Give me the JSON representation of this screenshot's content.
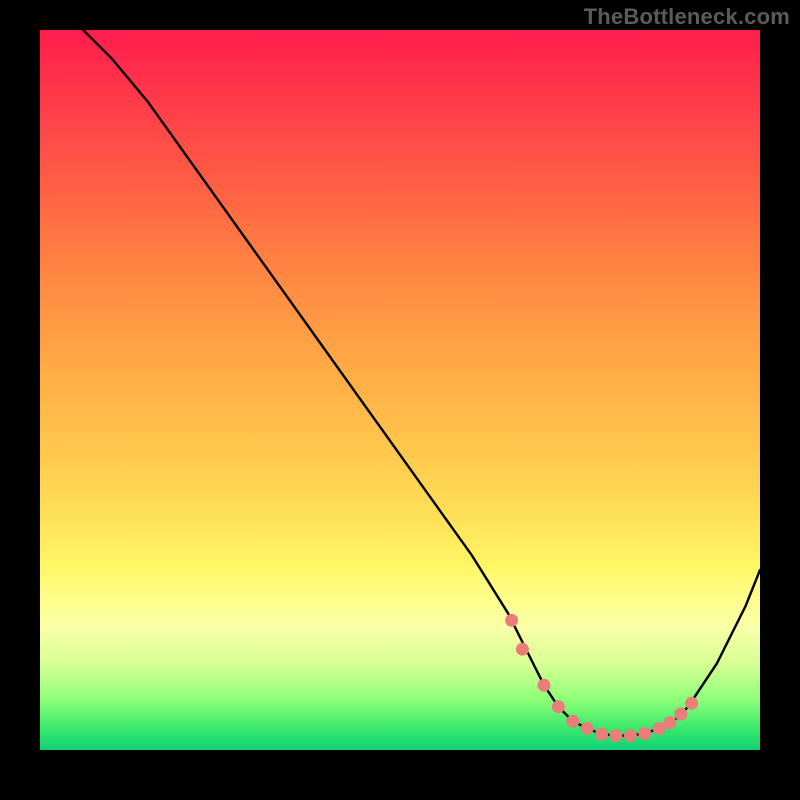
{
  "watermark": "TheBottleneck.com",
  "chart_data": {
    "type": "line",
    "title": "",
    "xlabel": "",
    "ylabel": "",
    "xlim": [
      0,
      100
    ],
    "ylim": [
      0,
      100
    ],
    "series": [
      {
        "name": "bottleneck-curve",
        "x": [
          6,
          10,
          15,
          20,
          25,
          30,
          35,
          40,
          45,
          50,
          55,
          60,
          65,
          68,
          70,
          72,
          74,
          76,
          78,
          80,
          82,
          84,
          86,
          88,
          90,
          94,
          98,
          100
        ],
        "y": [
          100,
          96,
          90,
          83,
          76,
          69,
          62,
          55,
          48,
          41,
          34,
          27,
          19,
          13,
          9,
          6,
          4,
          3,
          2.2,
          2,
          2,
          2.3,
          3,
          4,
          6,
          12,
          20,
          25
        ]
      }
    ],
    "markers": {
      "name": "highlight-dots",
      "color": "#e97d79",
      "x": [
        65.5,
        67,
        70,
        72,
        74,
        76,
        78,
        80,
        82,
        84,
        86,
        87.5,
        89,
        90.5
      ],
      "y": [
        18,
        14,
        9,
        6,
        4,
        3,
        2.2,
        2,
        2,
        2.3,
        3,
        3.8,
        5,
        6.5
      ]
    },
    "gradient_stops": [
      {
        "pos": 0,
        "color": "#ff1d4d"
      },
      {
        "pos": 22,
        "color": "#ff6044"
      },
      {
        "pos": 46,
        "color": "#ffa844"
      },
      {
        "pos": 68,
        "color": "#ffe258"
      },
      {
        "pos": 83,
        "color": "#f9ffa8"
      },
      {
        "pos": 97,
        "color": "#38e86c"
      },
      {
        "pos": 100,
        "color": "#10d276"
      }
    ]
  }
}
